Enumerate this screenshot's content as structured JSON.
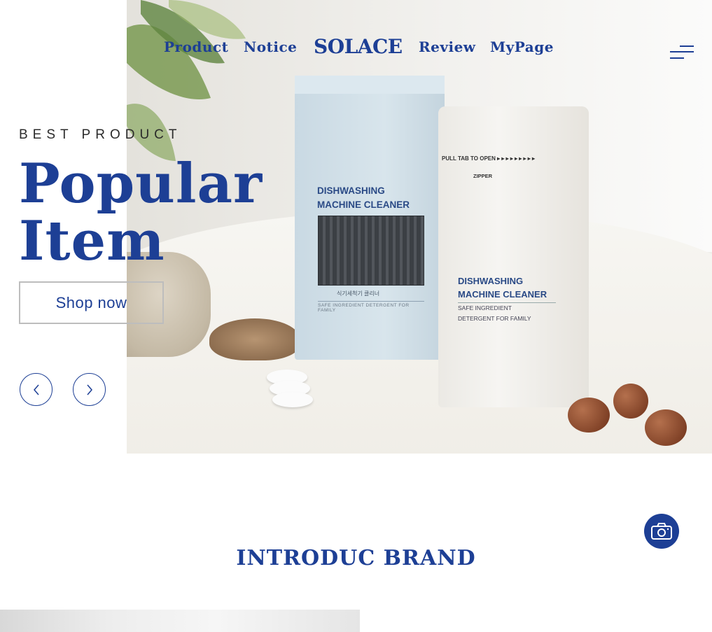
{
  "header": {
    "nav_left": [
      "Product",
      "Notice"
    ],
    "logo": "SOLACE",
    "nav_right": [
      "Review",
      "MyPage"
    ],
    "menu_icon": "hamburger-menu-icon"
  },
  "hero": {
    "eyebrow": "BEST PRODUCT",
    "headline_line1": "Popular",
    "headline_line2": "Item",
    "cta_label": "Shop now",
    "prev_icon": "chevron-left-icon",
    "next_icon": "chevron-right-icon",
    "product_box": {
      "title_line1": "DISHWASHING",
      "title_line2": "MACHINE CLEANER",
      "korean": "식기세척기 클리너",
      "subtitle": "SAFE INGREDIENT DETERGENT FOR FAMILY"
    },
    "product_pouch": {
      "pull_tab": "PULL TAB TO OPEN ▸ ▸ ▸ ▸ ▸ ▸ ▸ ▸ ▸",
      "zipper": "ZIPPER",
      "title_line1": "DISHWASHING",
      "title_line2": "MACHINE CLEANER",
      "subtitle_line1": "SAFE INGREDIENT",
      "subtitle_line2": "DETERGENT FOR FAMILY"
    }
  },
  "brand_section": {
    "title": "INTRODUC BRAND",
    "camera_icon": "camera-icon"
  },
  "colors": {
    "primary": "#1d3f95",
    "text_dark": "#2b2b2b",
    "border": "#bdbdbd"
  }
}
